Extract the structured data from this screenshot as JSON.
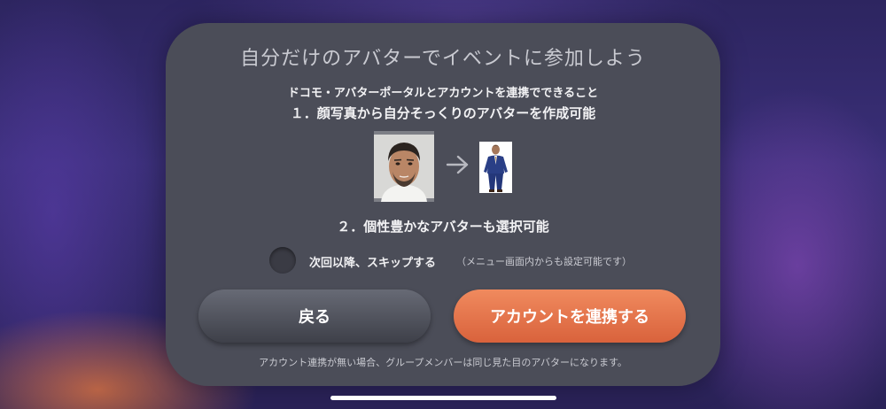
{
  "dialog": {
    "title": "自分だけのアバターでイベントに参加しよう",
    "description_line1": "ドコモ・アバターポータルとアカウントを連携でできること",
    "feature1": "１．顔写真から自分そっくりのアバターを作成可能",
    "feature2": "２．個性豊かなアバターも選択可能",
    "skip_label": "次回以降、スキップする",
    "skip_note": "（メニュー画面内からも設定可能です）",
    "skip_checked": false,
    "back_button": "戻る",
    "link_button": "アカウントを連携する",
    "footnote": "アカウント連携が無い場合、グループメンバーは同じ見た目のアバターになります。"
  },
  "colors": {
    "dialog_bg": "#4b4d58",
    "accent": "#e8714a",
    "secondary_button": "#50525c",
    "title_text": "#c9cad1"
  },
  "icons": {
    "arrow": "arrow-right-icon",
    "photo": "face-photo",
    "avatar": "avatar-figure"
  }
}
